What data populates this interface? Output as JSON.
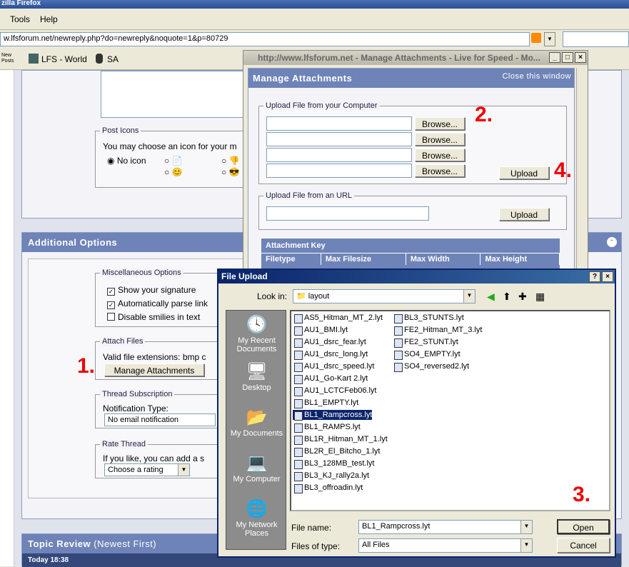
{
  "browser": {
    "title": "zilla Firefox",
    "menu": [
      "Tools",
      "Help"
    ],
    "url": "w.lfsforum.net/newreply.php?do=newreply&noquote=1&p=80729",
    "bookmarks": [
      "New Posts",
      "LFS - World",
      "SA"
    ]
  },
  "forum": {
    "post_icons": {
      "legend": "Post Icons",
      "desc": "You may choose an icon for your m",
      "no_icon": "No icon"
    },
    "additional_options": {
      "title": "Additional Options",
      "misc_legend": "Miscellaneous Options",
      "show_signature": "Show your signature",
      "parse_links": "Automatically parse link",
      "disable_smilies": "Disable smilies in text",
      "attach_legend": "Attach Files",
      "valid_ext": "Valid file extensions: bmp c",
      "manage_btn": "Manage Attachments",
      "sub_legend": "Thread Subscription",
      "notif_label": "Notification Type:",
      "notif_value": "No email notification",
      "rate_legend": "Rate Thread",
      "rate_desc": "If you like, you can add a s",
      "rate_value": "Choose a rating"
    },
    "topic_review": {
      "title": "Topic Review",
      "subtitle": "(Newest First)",
      "date": "Today 18:38"
    }
  },
  "popup": {
    "window_title": "http://www.lfsforum.net - Manage Attachments - Live for Speed - Mo...",
    "heading": "Manage Attachments",
    "close": "Close this window",
    "upload_legend": "Upload File from your Computer",
    "browse": "Browse...",
    "upload": "Upload",
    "url_legend": "Upload File from an URL",
    "key_title": "Attachment Key",
    "key_cols": [
      "Filetype",
      "Max Filesize",
      "Max Width",
      "Max Height"
    ]
  },
  "dialog": {
    "title": "File Upload",
    "look_in_label": "Look in:",
    "look_in_value": "layout",
    "places": [
      "My Recent Documents",
      "Desktop",
      "My Documents",
      "My Computer",
      "My Network Places"
    ],
    "files_col1": [
      "AS5_Hitman_MT_2.lyt",
      "AU1_BMI.lyt",
      "AU1_dsrc_fear.lyt",
      "AU1_dsrc_long.lyt",
      "AU1_dsrc_speed.lyt",
      "AU1_Go-Kart 2.lyt",
      "AU1_LCTCFeb06.lyt",
      "BL1_EMPTY.lyt",
      "BL1_Rampcross.lyt",
      "BL1_RAMPS.lyt",
      "BL1R_Hitman_MT_1.lyt",
      "BL2R_El_Bitcho_1.lyt",
      "BL3_128MB_test.lyt",
      "BL3_KJ_rally2a.lyt",
      "BL3_offroadin.lyt"
    ],
    "files_col2": [
      "BL3_STUNTS.lyt",
      "FE2_Hitman_MT_3.lyt",
      "FE2_STUNT.lyt",
      "SO4_EMPTY.lyt",
      "SO4_reversed2.lyt"
    ],
    "selected": "BL1_Rampcross.lyt",
    "filename_label": "File name:",
    "filename_value": "BL1_Rampcross.lyt",
    "filetype_label": "Files of type:",
    "filetype_value": "All Files",
    "open": "Open",
    "cancel": "Cancel"
  },
  "annotations": [
    "1.",
    "2.",
    "3.",
    "4."
  ]
}
